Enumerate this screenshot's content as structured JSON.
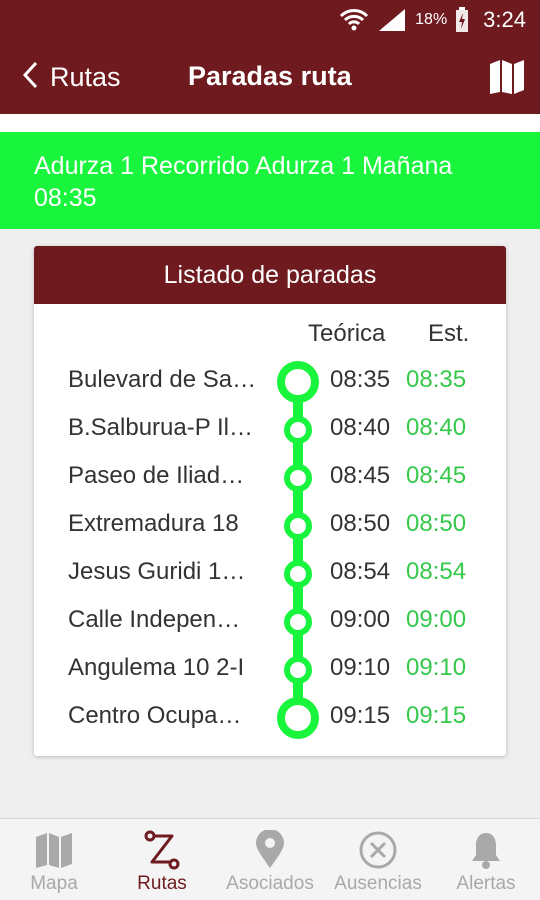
{
  "status_bar": {
    "battery": "18%",
    "time": "3:24"
  },
  "header": {
    "back_label": "Rutas",
    "title": "Paradas ruta"
  },
  "banner": {
    "line1": "Adurza 1 Recorrido Adurza 1 Mañana",
    "line2": "08:35"
  },
  "card": {
    "title": "Listado de paradas",
    "col_theoretical": "Teórica",
    "col_estimated": "Est.",
    "stops": [
      {
        "name": "Bulevard de Sa…",
        "theoretical": "08:35",
        "estimated": "08:35"
      },
      {
        "name": "B.Salburua-P Il…",
        "theoretical": "08:40",
        "estimated": "08:40"
      },
      {
        "name": "Paseo de Iliad…",
        "theoretical": "08:45",
        "estimated": "08:45"
      },
      {
        "name": "Extremadura 18",
        "theoretical": "08:50",
        "estimated": "08:50"
      },
      {
        "name": "Jesus Guridi 1…",
        "theoretical": "08:54",
        "estimated": "08:54"
      },
      {
        "name": "Calle Indepen…",
        "theoretical": "09:00",
        "estimated": "09:00"
      },
      {
        "name": "Angulema 10 2-I",
        "theoretical": "09:10",
        "estimated": "09:10"
      },
      {
        "name": "Centro Ocupa…",
        "theoretical": "09:15",
        "estimated": "09:15"
      }
    ]
  },
  "bottom_nav": {
    "items": [
      {
        "label": "Mapa",
        "icon": "map-icon",
        "active": false
      },
      {
        "label": "Rutas",
        "icon": "route-icon",
        "active": true
      },
      {
        "label": "Asociados",
        "icon": "location-pin-icon",
        "active": false
      },
      {
        "label": "Ausencias",
        "icon": "cancel-circle-icon",
        "active": false
      },
      {
        "label": "Alertas",
        "icon": "bell-icon",
        "active": false
      }
    ]
  },
  "colors": {
    "brand": "#6e1a1f",
    "accent_green": "#19f53d",
    "estimated_green": "#35c84a",
    "inactive_gray": "#a9a9a9"
  }
}
